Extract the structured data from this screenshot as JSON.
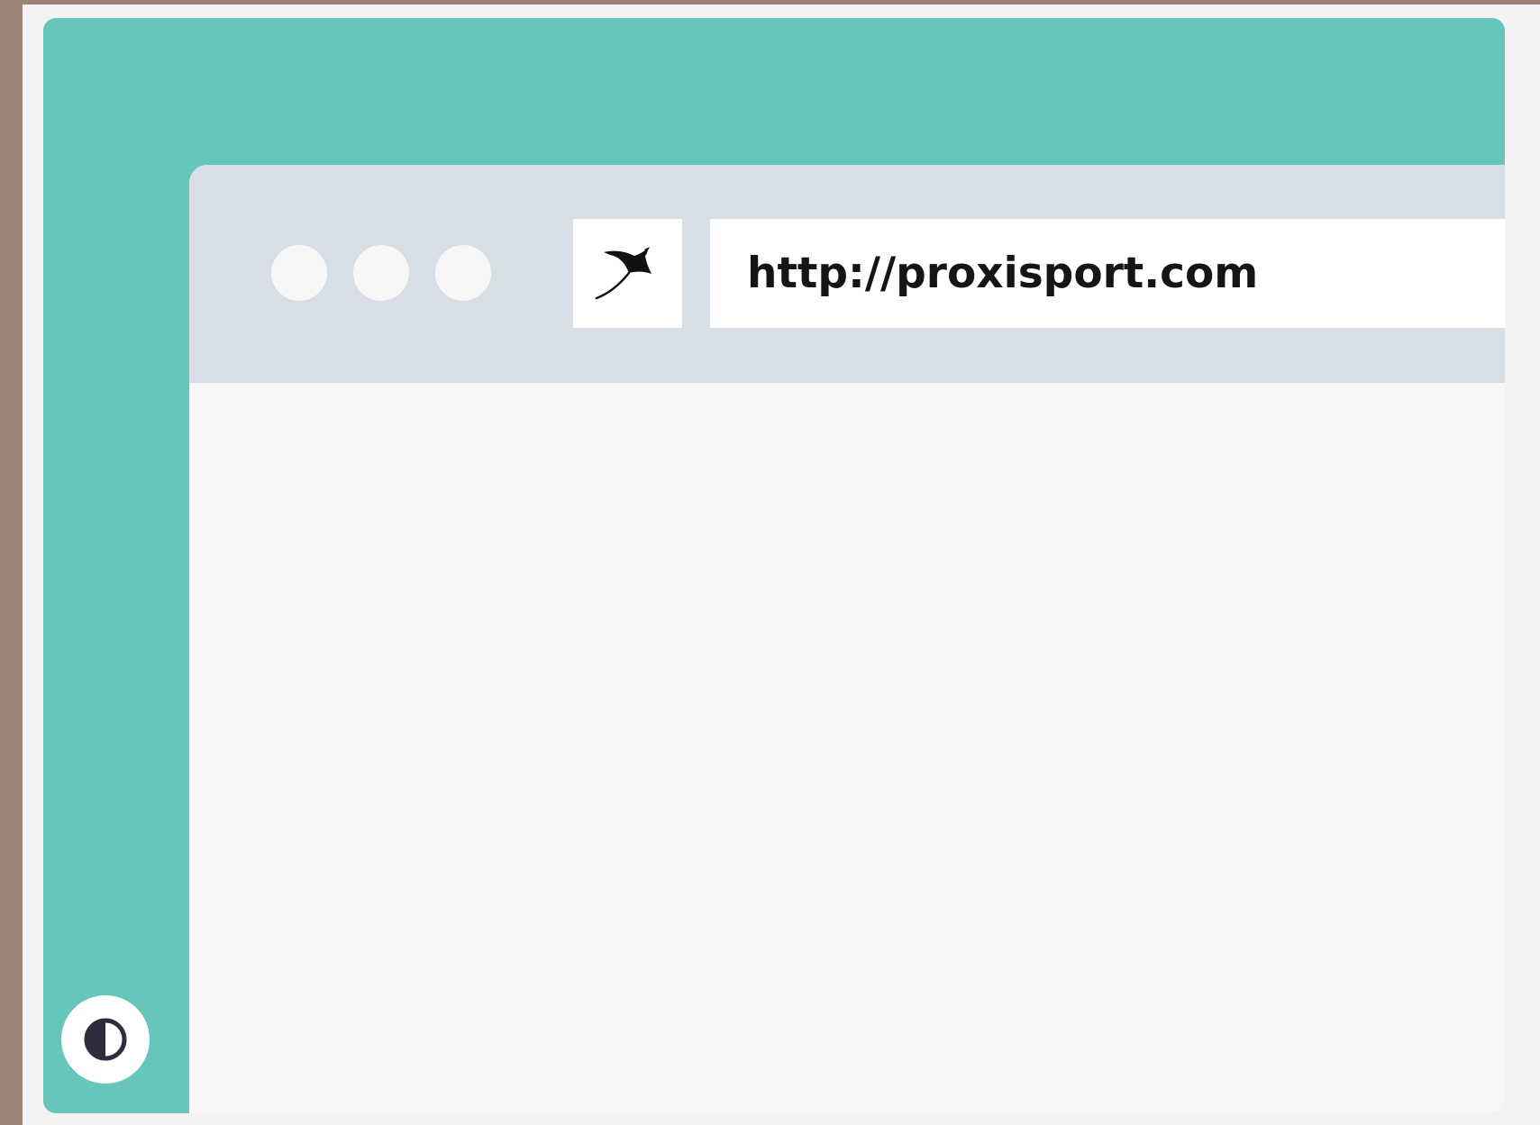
{
  "browser": {
    "url": "http://proxisport.com"
  },
  "icons": {
    "favicon": "manta-ray-logo",
    "contrast_toggle": "contrast-icon"
  },
  "colors": {
    "background": "#9a8377",
    "frame": "#f3f3f3",
    "accent_teal": "#67c6bb",
    "toolbar": "#d8dee6",
    "content": "#f7f7f7",
    "text": "#151515",
    "icon_dark": "#2f2d3d"
  }
}
